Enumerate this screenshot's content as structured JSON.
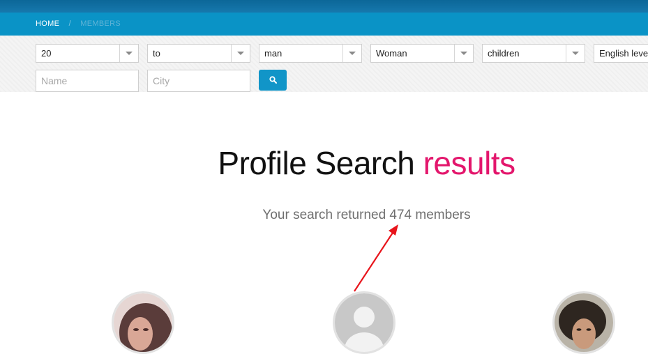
{
  "breadcrumb": {
    "home": "HOME",
    "separator": "/",
    "current": "MEMBERS"
  },
  "filters": {
    "age_from": "20",
    "age_to": "to",
    "gender": "man",
    "seeking": "Woman",
    "children": "children",
    "english_level": "English level",
    "name_placeholder": "Name",
    "city_placeholder": "City"
  },
  "search_button": {
    "icon": "search-icon"
  },
  "heading": {
    "main": "Profile Search",
    "accent": "results"
  },
  "results": {
    "summary": "Your search returned 474 members"
  },
  "colors": {
    "topbar": "#0f6fa3",
    "breadcrumb_bar": "#0a93c6",
    "accent": "#e3166c",
    "button": "#1195c8",
    "annotation_arrow": "#e8141b"
  }
}
